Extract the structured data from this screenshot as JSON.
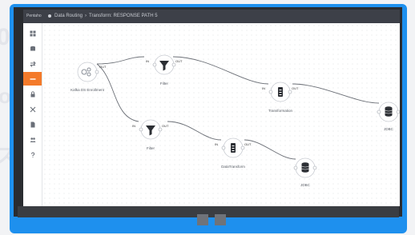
{
  "header": {
    "brand": "Pentaho",
    "breadcrumb": [
      "Data Routing",
      "Transform: RESPONSE PATH 5"
    ]
  },
  "sidebar": {
    "items": [
      {
        "name": "sidebar-item-dashboard",
        "icon": "grid-icon",
        "active": false
      },
      {
        "name": "sidebar-item-storage",
        "icon": "database-icon",
        "active": false
      },
      {
        "name": "sidebar-item-transfer",
        "icon": "arrows-icon",
        "active": false
      },
      {
        "name": "sidebar-item-pipelines",
        "icon": "minus-icon",
        "active": true
      },
      {
        "name": "sidebar-item-security",
        "icon": "lock-icon",
        "active": false
      },
      {
        "name": "sidebar-item-tools",
        "icon": "close-icon",
        "active": false
      },
      {
        "name": "sidebar-item-documents",
        "icon": "file-icon",
        "active": false
      },
      {
        "name": "sidebar-item-users",
        "icon": "users-icon",
        "active": false
      },
      {
        "name": "sidebar-item-help",
        "icon": "question-icon",
        "active": false
      }
    ]
  },
  "flow": {
    "source_label": "Kafka DS Enrollment",
    "filter1_label": "Filter",
    "filter2_label": "Filter",
    "transform1_label": "Transformation",
    "transform2_label": "DataTransform",
    "sink1_label": "JDBC",
    "sink2_label": "JDBC",
    "port_in": "IN",
    "port_out": "OUT"
  },
  "colors": {
    "accent": "#f47a2a",
    "monitor_frame": "#1e90ee",
    "topbar": "#3d4048"
  }
}
